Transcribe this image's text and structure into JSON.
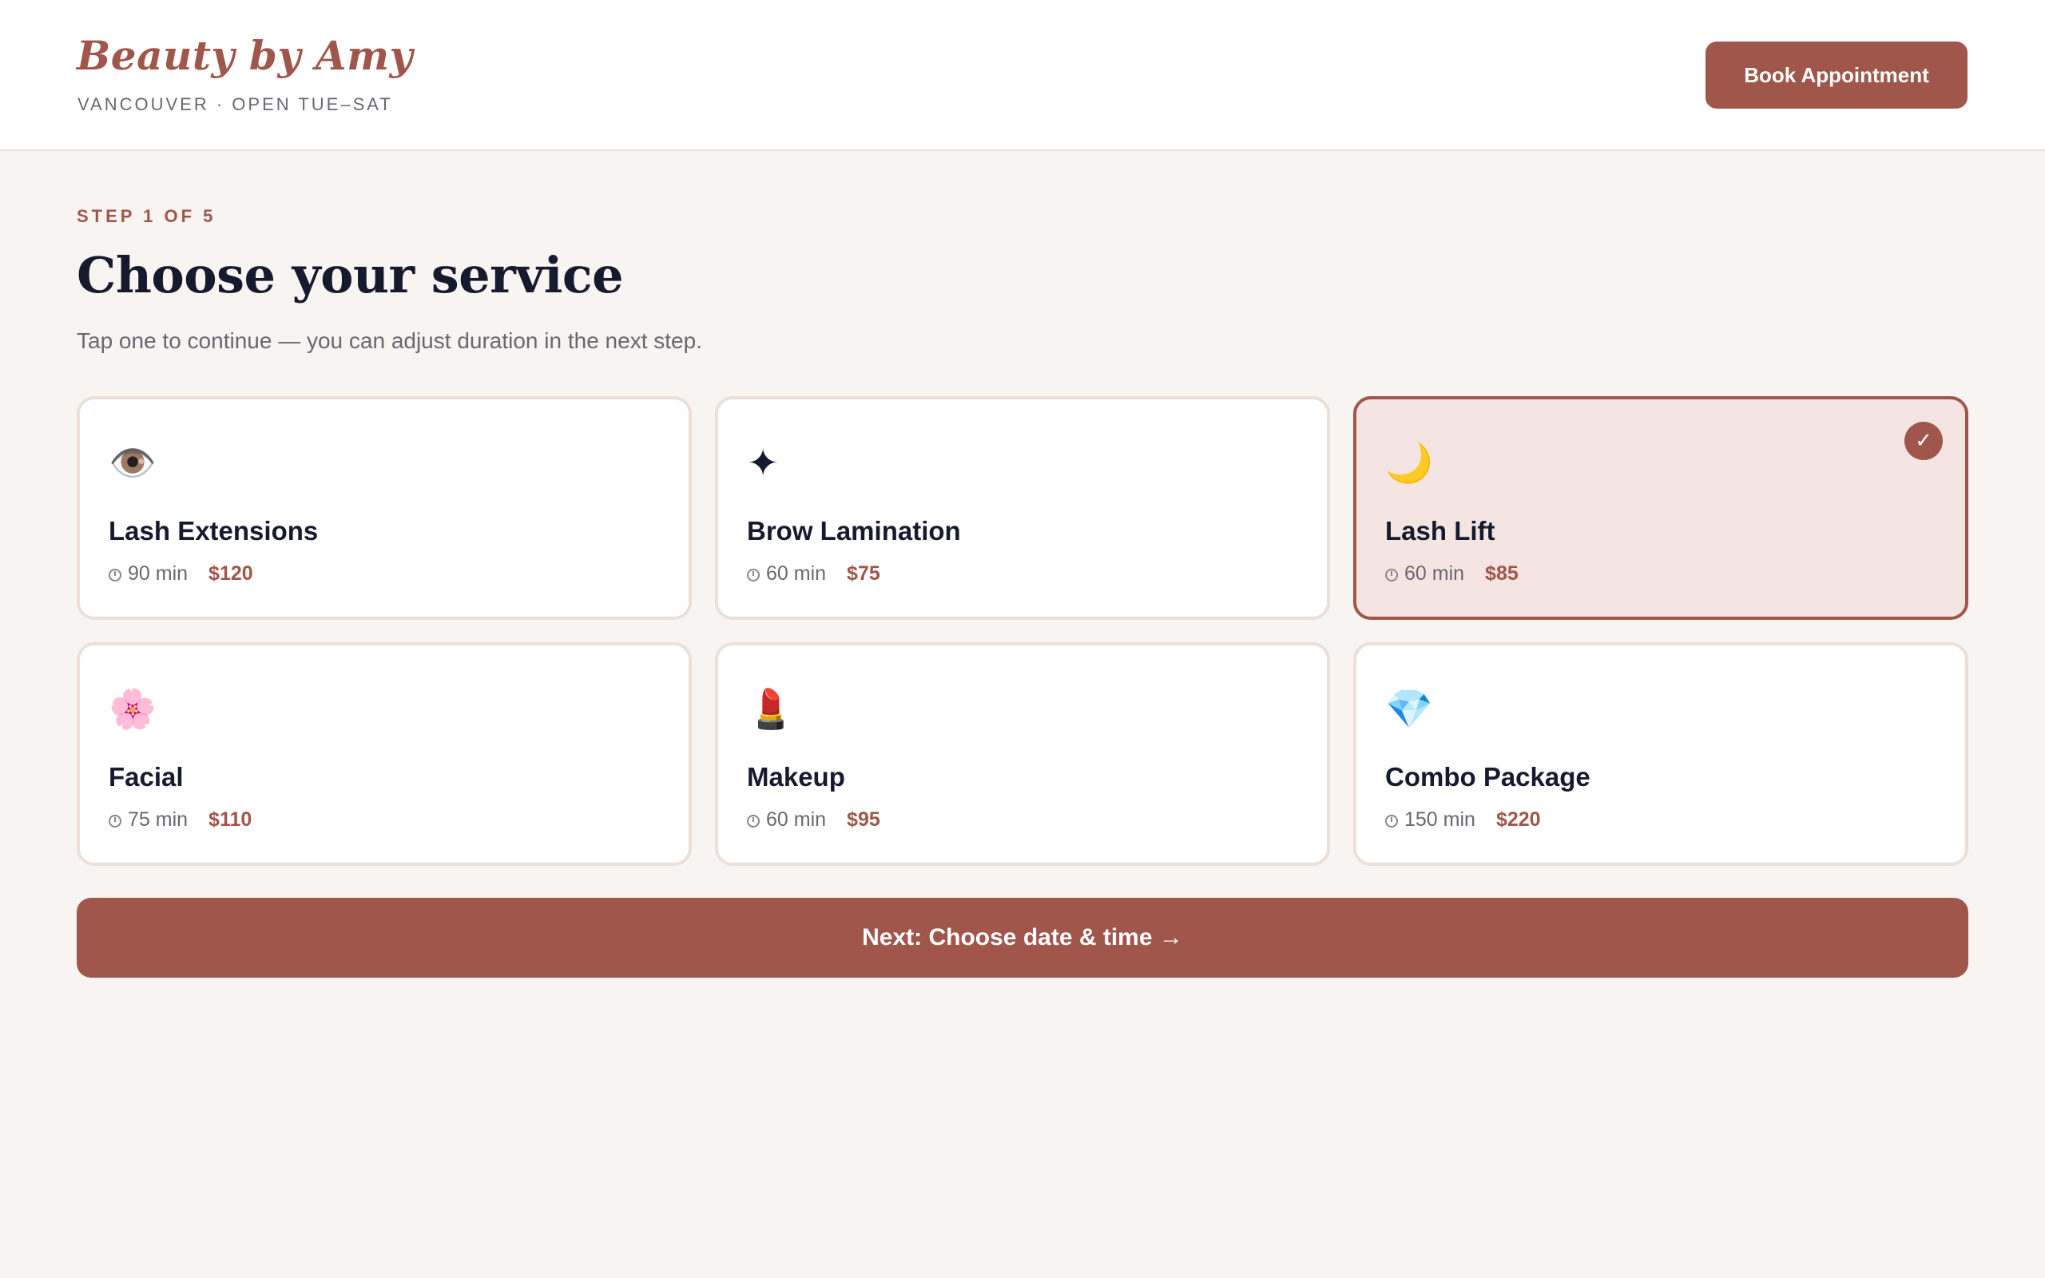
{
  "header": {
    "brand_name": "Beauty by Amy",
    "brand_sub": "VANCOUVER · OPEN TUE–SAT",
    "book_label": "Book Appointment"
  },
  "main": {
    "step_label": "STEP 1 OF 5",
    "title": "Choose your service",
    "subtitle": "Tap one to continue — you can adjust duration in the next step.",
    "services": [
      {
        "icon": "👁️",
        "icon_name": "eye-icon",
        "name": "Lash Extensions",
        "duration": "90 min",
        "price": "$120",
        "selected": false
      },
      {
        "icon": "✦",
        "icon_name": "sparkle-icon",
        "name": "Brow Lamination",
        "duration": "60 min",
        "price": "$75",
        "selected": false
      },
      {
        "icon": "🌙",
        "icon_name": "moon-icon",
        "name": "Lash Lift",
        "duration": "60 min",
        "price": "$85",
        "selected": true
      },
      {
        "icon": "🌸",
        "icon_name": "flower-icon",
        "name": "Facial",
        "duration": "75 min",
        "price": "$110",
        "selected": false
      },
      {
        "icon": "💄",
        "icon_name": "lipstick-icon",
        "name": "Makeup",
        "duration": "60 min",
        "price": "$95",
        "selected": false
      },
      {
        "icon": "💎",
        "icon_name": "gem-icon",
        "name": "Combo Package",
        "duration": "150 min",
        "price": "$220",
        "selected": false
      }
    ],
    "next_label": "Next: Choose date & time →"
  },
  "colors": {
    "accent": "#a0564a",
    "background": "#f8f4f1",
    "card_border": "#ecdfd8",
    "selected_bg": "#f5e5e2",
    "text_dark": "#161a2e",
    "text_muted": "#6b6670"
  }
}
